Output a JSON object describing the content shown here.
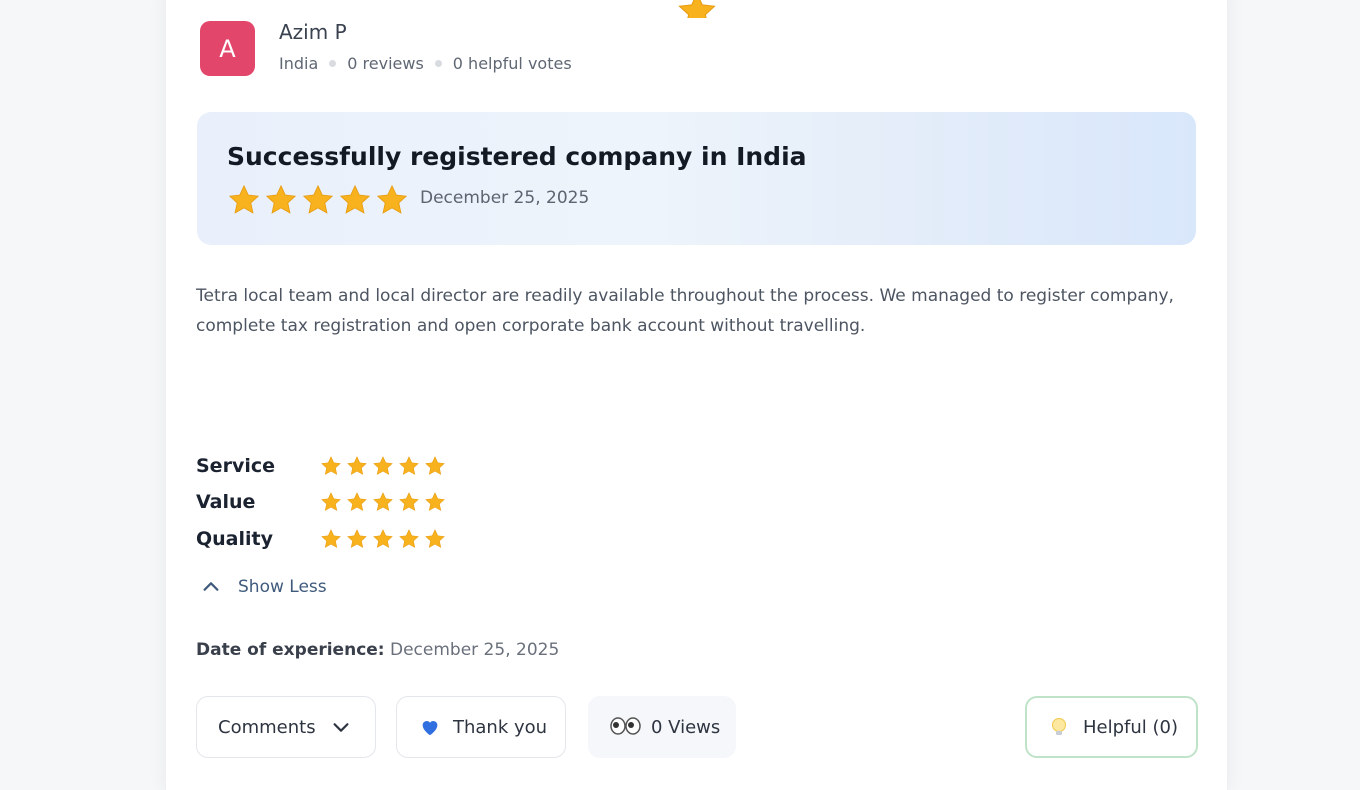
{
  "author": {
    "initial": "A",
    "name": "Azim P",
    "country": "India",
    "reviews": "0 reviews",
    "helpful_votes": "0 helpful votes",
    "avatar_color": "#e2466a"
  },
  "review": {
    "title": "Successfully registered company in India",
    "rating": 5,
    "date": "December 25, 2025",
    "body": "Tetra local team and local director are readily available throughout the process. We managed to register company, complete tax registration and open corporate bank account without travelling."
  },
  "ratings": [
    {
      "label": "Service",
      "stars": 5
    },
    {
      "label": "Value",
      "stars": 5
    },
    {
      "label": "Quality",
      "stars": 5
    }
  ],
  "show_less_label": "Show Less",
  "date_of_experience": {
    "label": "Date of experience:",
    "value": "December 25, 2025"
  },
  "actions": {
    "comments_label": "Comments",
    "thank_you_label": "Thank you",
    "views_label": "0 Views",
    "helpful_label": "Helpful (0)"
  },
  "colors": {
    "star": "#f7b21e",
    "accent_blue": "#3f5a7c",
    "helpful_border": "#bfe3c8"
  },
  "icons": [
    "star-icon",
    "chevron-up-icon",
    "chevron-down-icon",
    "blue-heart-icon",
    "eyes-icon",
    "lightbulb-icon"
  ]
}
